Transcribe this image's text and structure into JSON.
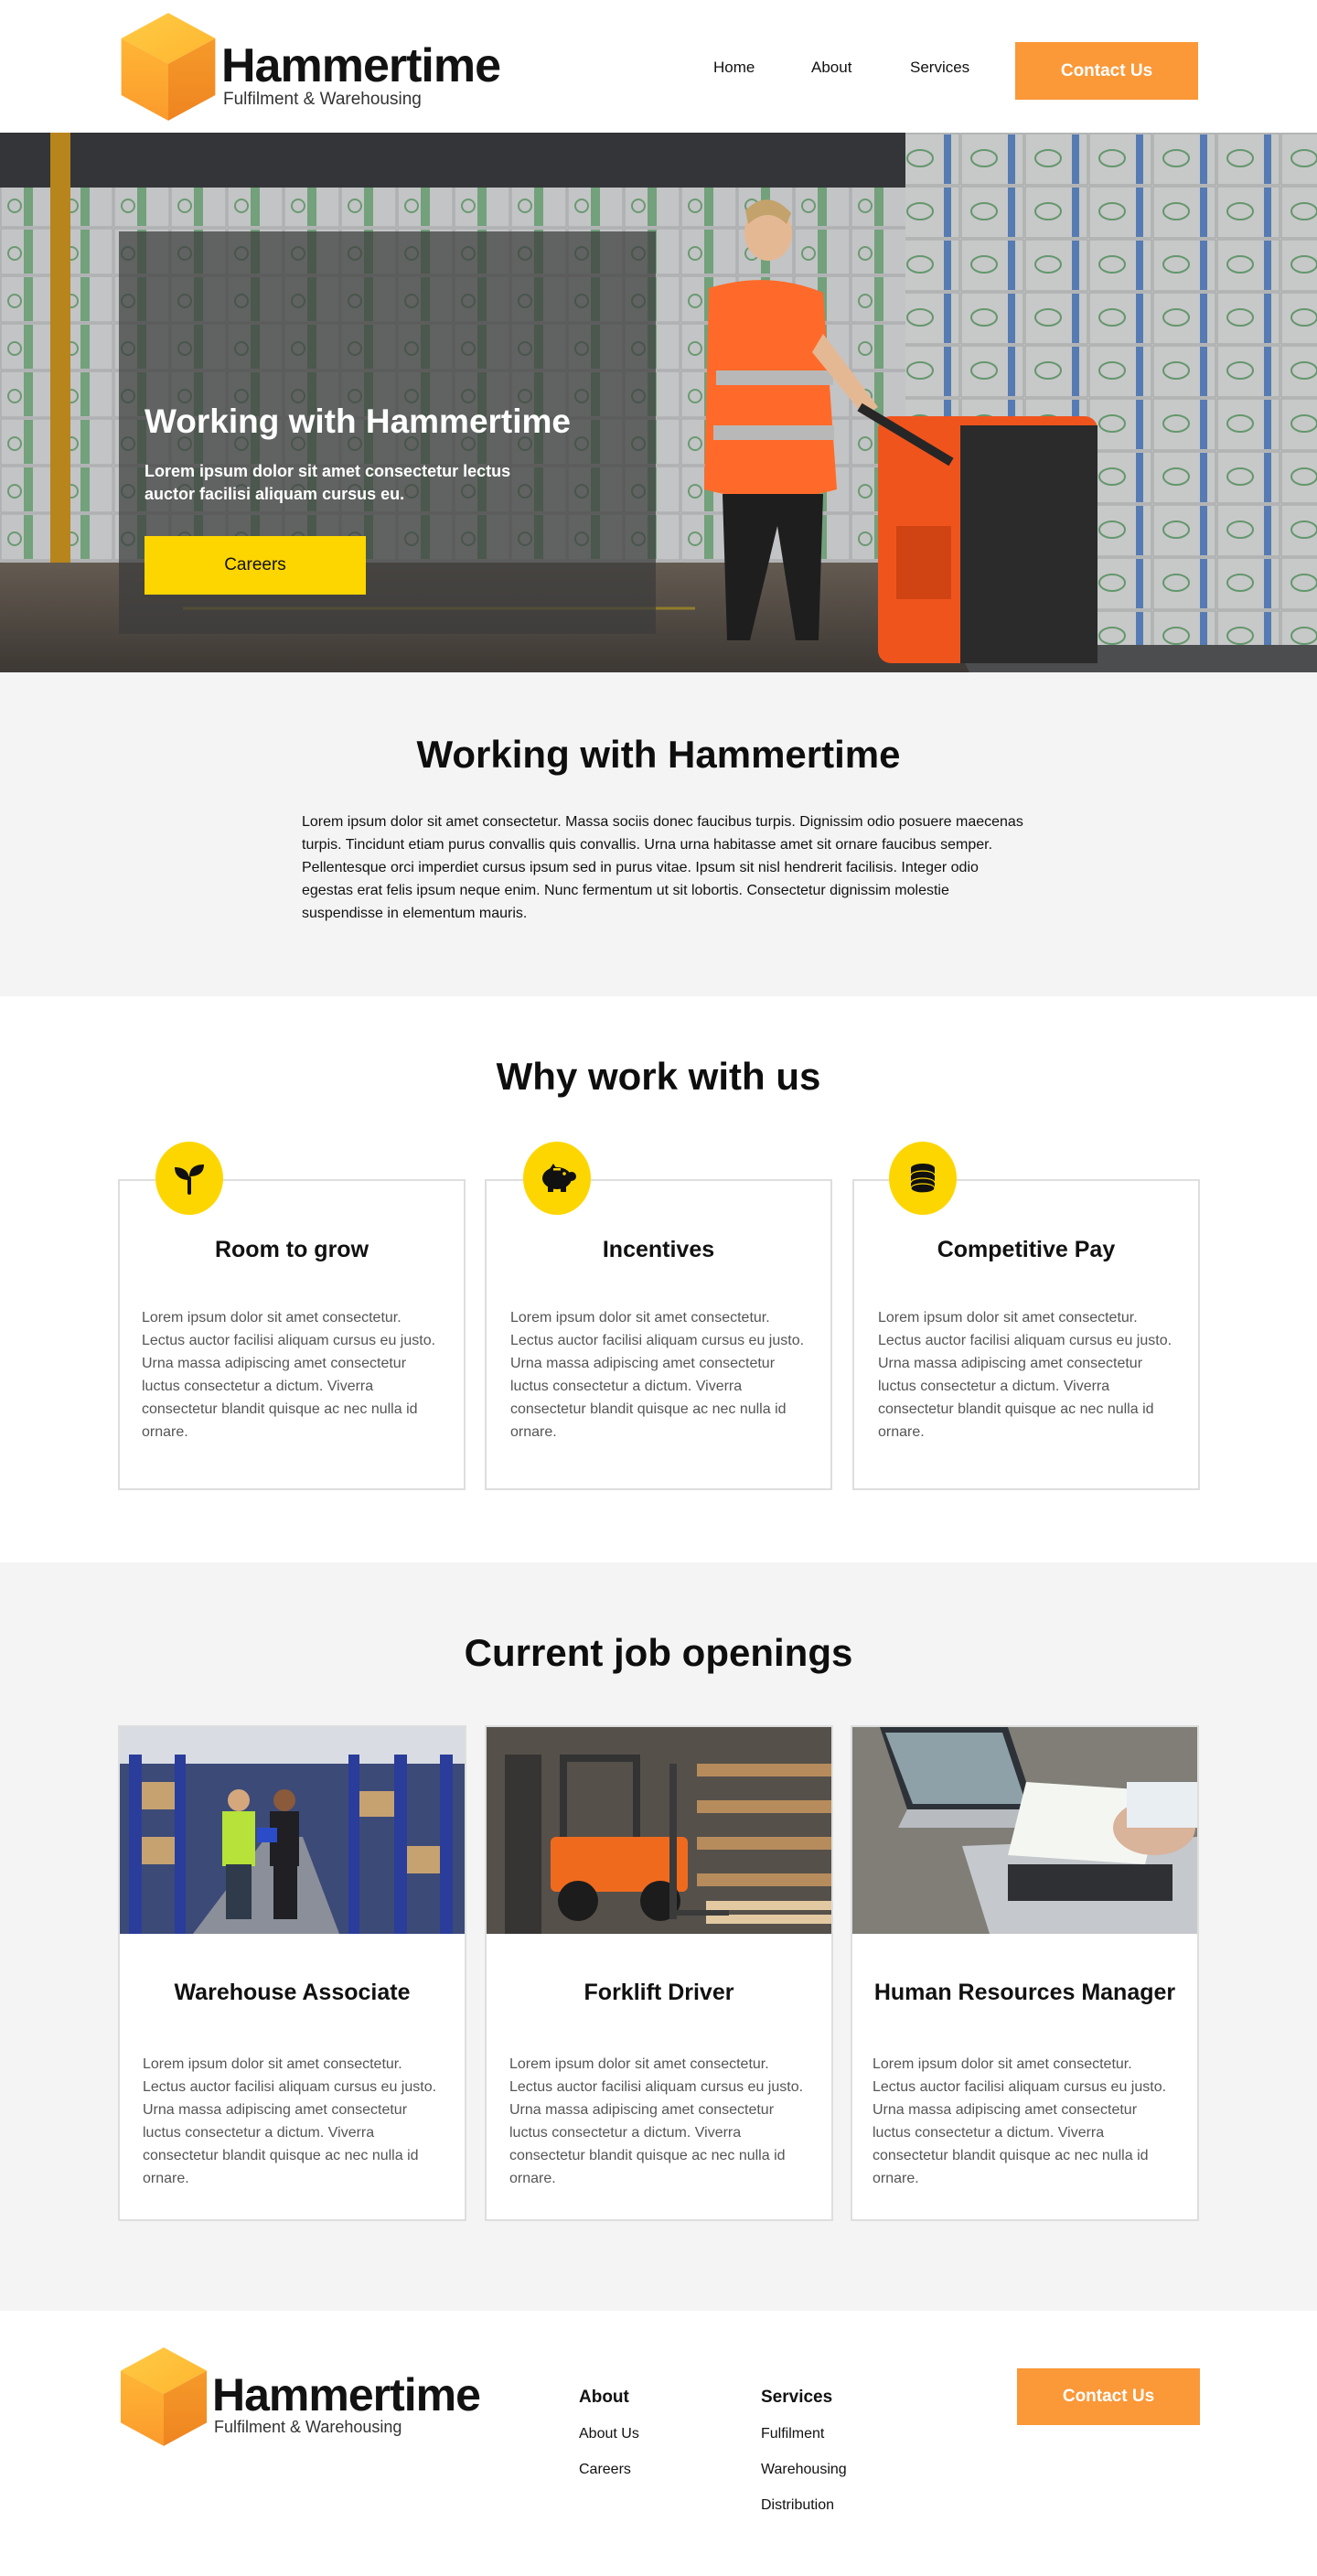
{
  "brand": {
    "name": "Hammertime",
    "tagline": "Fulfilment & Warehousing",
    "accent": "#fb9838",
    "highlight": "#fdd600"
  },
  "header": {
    "nav": [
      "Home",
      "About",
      "Services"
    ],
    "contact_label": "Contact Us"
  },
  "hero": {
    "title": "Working with Hammertime",
    "subtitle": "Lorem ipsum dolor sit amet consectetur lectus auctor facilisi aliquam cursus eu.",
    "button_label": "Careers"
  },
  "intro": {
    "title": "Working with Hammertime",
    "text": "Lorem ipsum dolor sit amet consectetur. Massa sociis donec faucibus turpis. Dignissim odio posuere maecenas turpis. Tincidunt etiam purus convallis quis convallis. Urna urna habitasse amet sit ornare faucibus semper. Pellentesque orci imperdiet cursus ipsum sed in purus vitae. Ipsum sit nisl hendrerit facilisis. Integer odio egestas erat felis ipsum neque enim. Nunc fermentum ut sit lobortis. Consectetur dignissim molestie suspendisse in elementum mauris."
  },
  "why": {
    "title": "Why work with us",
    "cards": [
      {
        "icon": "sprout-icon",
        "title": "Room to grow",
        "text": "Lorem ipsum dolor sit amet consectetur. Lectus auctor facilisi aliquam cursus eu justo. Urna massa adipiscing amet consectetur luctus consectetur a dictum. Viverra consectetur blandit quisque ac nec nulla id ornare."
      },
      {
        "icon": "piggy-bank-icon",
        "title": "Incentives",
        "text": "Lorem ipsum dolor sit amet consectetur. Lectus auctor facilisi aliquam cursus eu justo. Urna massa adipiscing amet consectetur luctus consectetur a dictum. Viverra consectetur blandit quisque ac nec nulla id ornare."
      },
      {
        "icon": "coins-icon",
        "title": "Competitive Pay",
        "text": "Lorem ipsum dolor sit amet consectetur. Lectus auctor facilisi aliquam cursus eu justo. Urna massa adipiscing amet consectetur luctus consectetur a dictum. Viverra consectetur blandit quisque ac nec nulla id ornare."
      }
    ]
  },
  "jobs": {
    "title": "Current job openings",
    "cards": [
      {
        "title": "Warehouse Associate",
        "text": "Lorem ipsum dolor sit amet consectetur. Lectus auctor facilisi aliquam cursus eu justo. Urna massa adipiscing amet consectetur luctus consectetur a dictum. Viverra consectetur blandit quisque ac nec nulla id ornare."
      },
      {
        "title": "Forklift Driver",
        "text": "Lorem ipsum dolor sit amet consectetur. Lectus auctor facilisi aliquam cursus eu justo. Urna massa adipiscing amet consectetur luctus consectetur a dictum. Viverra consectetur blandit quisque ac nec nulla id ornare."
      },
      {
        "title": "Human Resources Manager",
        "text": "Lorem ipsum dolor sit amet consectetur. Lectus auctor facilisi aliquam cursus eu justo. Urna massa adipiscing amet consectetur luctus consectetur a dictum. Viverra consectetur blandit quisque ac nec nulla id ornare."
      }
    ]
  },
  "footer": {
    "about": {
      "heading": "About",
      "links": [
        "About Us",
        "Careers"
      ]
    },
    "services": {
      "heading": "Services",
      "links": [
        "Fulfilment",
        "Warehousing",
        "Distribution"
      ]
    },
    "contact_label": "Contact Us"
  }
}
